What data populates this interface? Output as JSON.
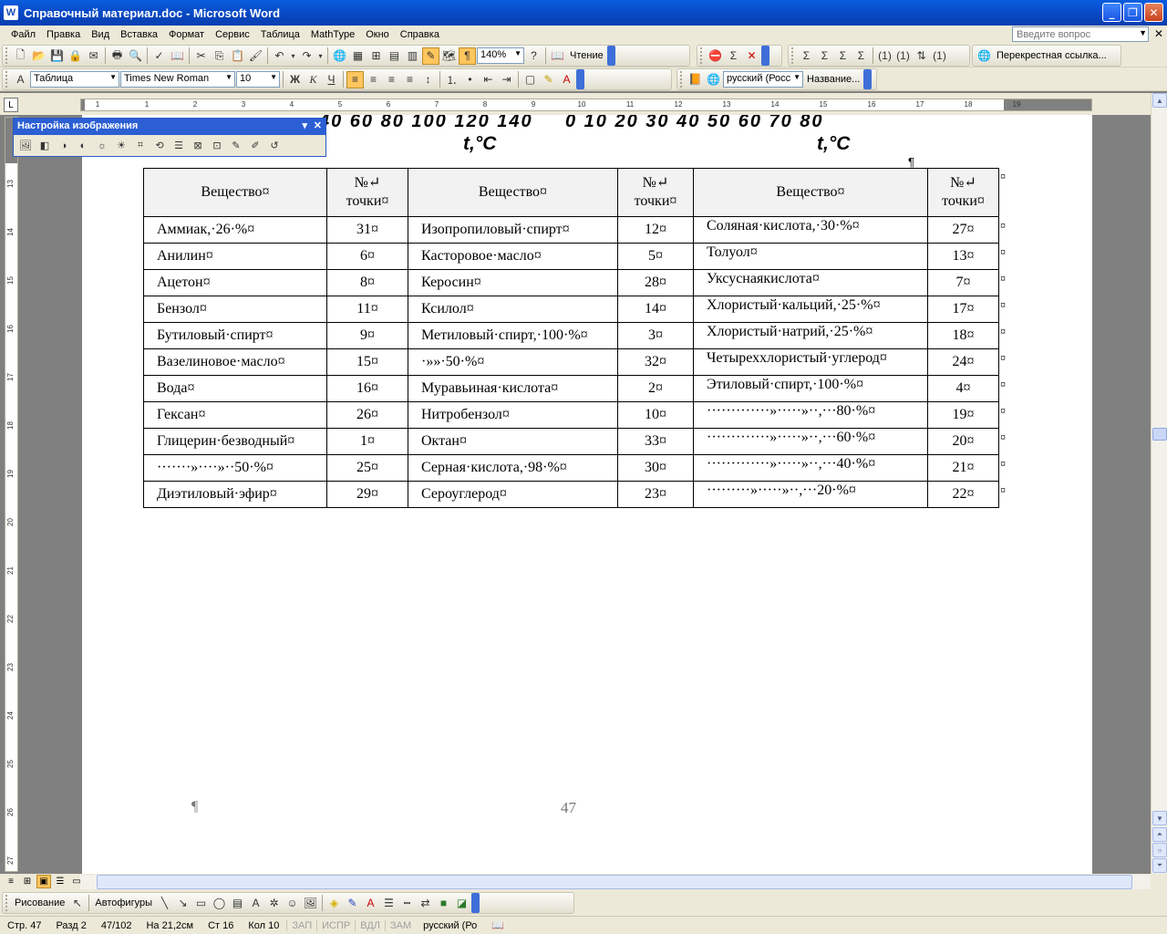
{
  "window": {
    "title": "Справочный материал.doc - Microsoft Word",
    "app_icon": "W",
    "controls": {
      "minimize": "_",
      "maximize": "❐",
      "close": "✕"
    }
  },
  "menubar": {
    "items": [
      "Файл",
      "Правка",
      "Вид",
      "Вставка",
      "Формат",
      "Сервис",
      "Таблица",
      "MathType",
      "Окно",
      "Справка"
    ],
    "ask_placeholder": "Введите вопрос"
  },
  "standard_toolbar": {
    "zoom": "140%",
    "reading_label": "Чтение"
  },
  "formatting_toolbar": {
    "style": "Таблица",
    "font": "Times New Roman",
    "size": "10",
    "bold": "Ж",
    "italic": "К",
    "underline": "Ч",
    "language": "русский (Росс",
    "name_label": "Название..."
  },
  "cross_ref_label": "Перекрестная ссылка...",
  "ruler": {
    "h_numbers": [
      "1",
      "1",
      "2",
      "3",
      "4",
      "5",
      "6",
      "7",
      "8",
      "9",
      "10",
      "11",
      "12",
      "13",
      "14",
      "15",
      "16",
      "17",
      "18",
      "19"
    ],
    "v_numbers": [
      "13",
      "14",
      "15",
      "16",
      "17",
      "18",
      "19",
      "20",
      "21",
      "22",
      "23",
      "24",
      "25",
      "26",
      "27"
    ]
  },
  "picture_toolbar": {
    "title": "Настройка изображения"
  },
  "figure": {
    "left_axis_numbers": "40  60  80  100 120 140",
    "right_axis_numbers": "0   10  20  30  40  50  60  70  80",
    "axis_label": "t,°C"
  },
  "table": {
    "headers": [
      "Вещество¤",
      "№↵ точки¤",
      "Вещество¤",
      "№↵ точки¤",
      "Вещество¤",
      "№↵ точки¤"
    ],
    "rows": [
      [
        "Аммиак,·26·%¤",
        "31¤",
        "Изопропиловый·спирт¤",
        "12¤",
        "Соляная·кислота,·30·%¤",
        "27¤"
      ],
      [
        "Анилин¤",
        "6¤",
        "Касторовое·масло¤",
        "5¤",
        "Толуол¤",
        "13¤"
      ],
      [
        "Ацетон¤",
        "8¤",
        "Керосин¤",
        "28¤",
        "Уксуснаякислота¤",
        "7¤"
      ],
      [
        "Бензол¤",
        "11¤",
        "Ксилол¤",
        "14¤",
        "Хлористый·кальций,·25·%¤",
        "17¤"
      ],
      [
        "Бутиловый·спирт¤",
        "9¤",
        "Метиловый·спирт,·100·%¤",
        "3¤",
        "Хлористый·натрий,·25·%¤",
        "18¤"
      ],
      [
        "Вазелиновое·масло¤",
        "15¤",
        "·»»·50·%¤",
        "32¤",
        "Четыреххлористый·углерод¤",
        "24¤"
      ],
      [
        "Вода¤",
        "16¤",
        "Муравьиная·кислота¤",
        "2¤",
        "Этиловый·спирт,·100·%¤",
        "4¤"
      ],
      [
        "Гексан¤",
        "26¤",
        "Нитробензол¤",
        "10¤",
        "·············»·····»··,···80·%¤",
        "19¤"
      ],
      [
        "Глицерин·безводный¤",
        "1¤",
        "Октан¤",
        "33¤",
        "·············»·····»··,···60·%¤",
        "20¤"
      ],
      [
        "·······»····»··50·%¤",
        "25¤",
        "Серная·кислота,·98·%¤",
        "30¤",
        "·············»·····»··,···40·%¤",
        "21¤"
      ],
      [
        "Диэтиловый·эфир¤",
        "29¤",
        "Сероуглерод¤",
        "23¤",
        "·········»·····»··,···20·%¤",
        "22¤"
      ]
    ],
    "row_end_mark": "¤"
  },
  "page": {
    "pilcrow": "¶",
    "number": "47"
  },
  "drawing_toolbar": {
    "draw_label": "Рисование",
    "autoshapes_label": "Автофигуры"
  },
  "statusbar": {
    "page": "Стр.  47",
    "section": "Разд  2",
    "pages": "47/102",
    "position": "На  21,2см",
    "line": "Ст  16",
    "column": "Кол  10",
    "rec": "ЗАП",
    "trk": "ИСПР",
    "ext": "ВДЛ",
    "ovr": "ЗАМ",
    "language": "русский (Ро"
  }
}
